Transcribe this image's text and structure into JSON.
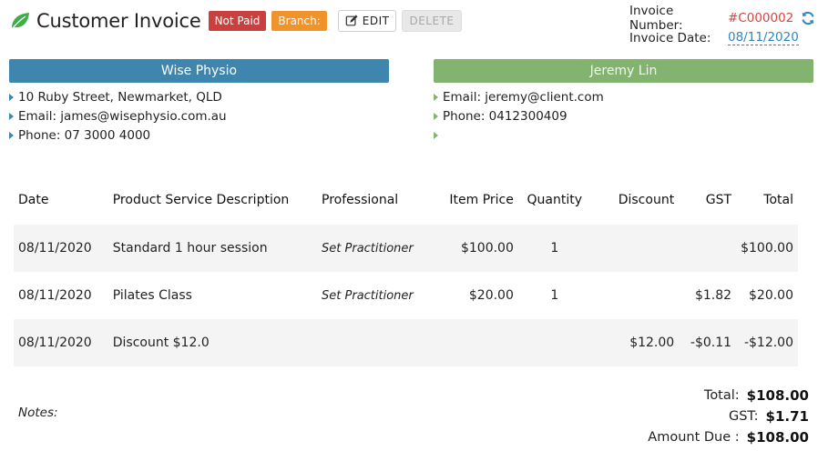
{
  "header": {
    "title": "Customer Invoice",
    "status_badge": "Not Paid",
    "branch_badge": "Branch:",
    "edit_label": "EDIT",
    "delete_label": "DELETE",
    "invoice_number_label": "Invoice Number:",
    "invoice_number": "#C000002",
    "invoice_date_label": "Invoice Date:",
    "invoice_date": "08/11/2020"
  },
  "business": {
    "name": "Wise Physio",
    "lines": [
      "10 Ruby Street, Newmarket, QLD",
      "Email: james@wisephysio.com.au",
      "Phone: 07 3000 4000"
    ]
  },
  "client": {
    "name": "Jeremy Lin",
    "lines": [
      "Email: jeremy@client.com",
      "Phone: 0412300409",
      ""
    ]
  },
  "table": {
    "headers": [
      "Date",
      "Product Service Description",
      "Professional",
      "Item Price",
      "Quantity",
      "Discount",
      "GST",
      "Total"
    ],
    "rows": [
      {
        "date": "08/11/2020",
        "desc": "Standard 1 hour session",
        "prof": "Set Practitioner",
        "price": "$100.00",
        "qty": "1",
        "discount": "",
        "gst": "",
        "total": "$100.00"
      },
      {
        "date": "08/11/2020",
        "desc": "Pilates Class",
        "prof": "Set Practitioner",
        "price": "$20.00",
        "qty": "1",
        "discount": "",
        "gst": "$1.82",
        "total": "$20.00"
      },
      {
        "date": "08/11/2020",
        "desc": "Discount $12.0",
        "prof": "",
        "price": "",
        "qty": "",
        "discount": "$12.00",
        "gst": "-$0.11",
        "total": "-$12.00"
      }
    ]
  },
  "notes_label": "Notes:",
  "totals": {
    "total_label": "Total:",
    "total": "$108.00",
    "gst_label": "GST:",
    "gst": "$1.71",
    "due_label": "Amount Due :",
    "due": "$108.00"
  },
  "colors": {
    "business_header": "#3e86ae",
    "client_header": "#82b36f",
    "not_paid": "#c9403f",
    "branch": "#f0932b",
    "accent_red": "#d64541",
    "link_blue": "#2e86c1"
  },
  "icons": {
    "logo": "leaf-icon",
    "edit": "pencil-icon",
    "refresh": "refresh-icon",
    "bullet": "triangle-right-icon"
  }
}
